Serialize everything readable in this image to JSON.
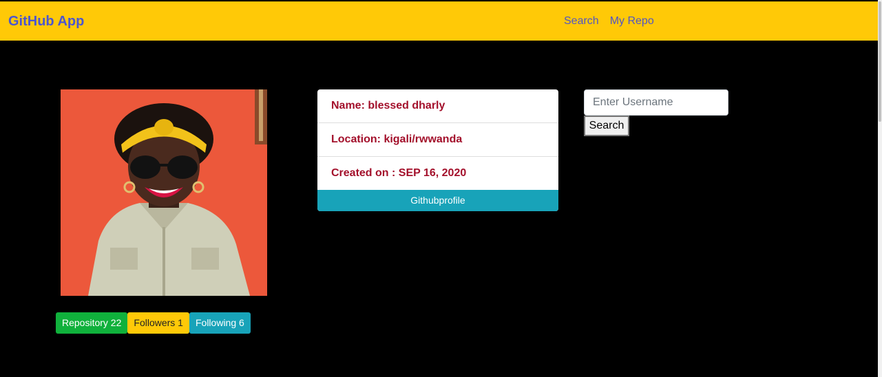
{
  "navbar": {
    "brand": "GitHub App",
    "links": [
      "Search",
      "My Repo"
    ]
  },
  "profile": {
    "name": "Name: blessed dharly",
    "location": "Location: kigali/rwwanda",
    "created": "Created on : SEP 16, 2020",
    "profile_button": "Githubprofile"
  },
  "stats": {
    "repository": "Repository 22",
    "followers": "Followers 1",
    "following": "Following 6"
  },
  "search": {
    "placeholder": "Enter Username",
    "button_label": "Search"
  },
  "colors": {
    "navbar": "#ffc907",
    "brand": "#4c56cf",
    "card_text": "#a3102b",
    "badge_repo": "#10b13c",
    "badge_followers": "#ffc908",
    "badge_following": "#18a3b9",
    "avatar_background": "#f05a3c"
  }
}
